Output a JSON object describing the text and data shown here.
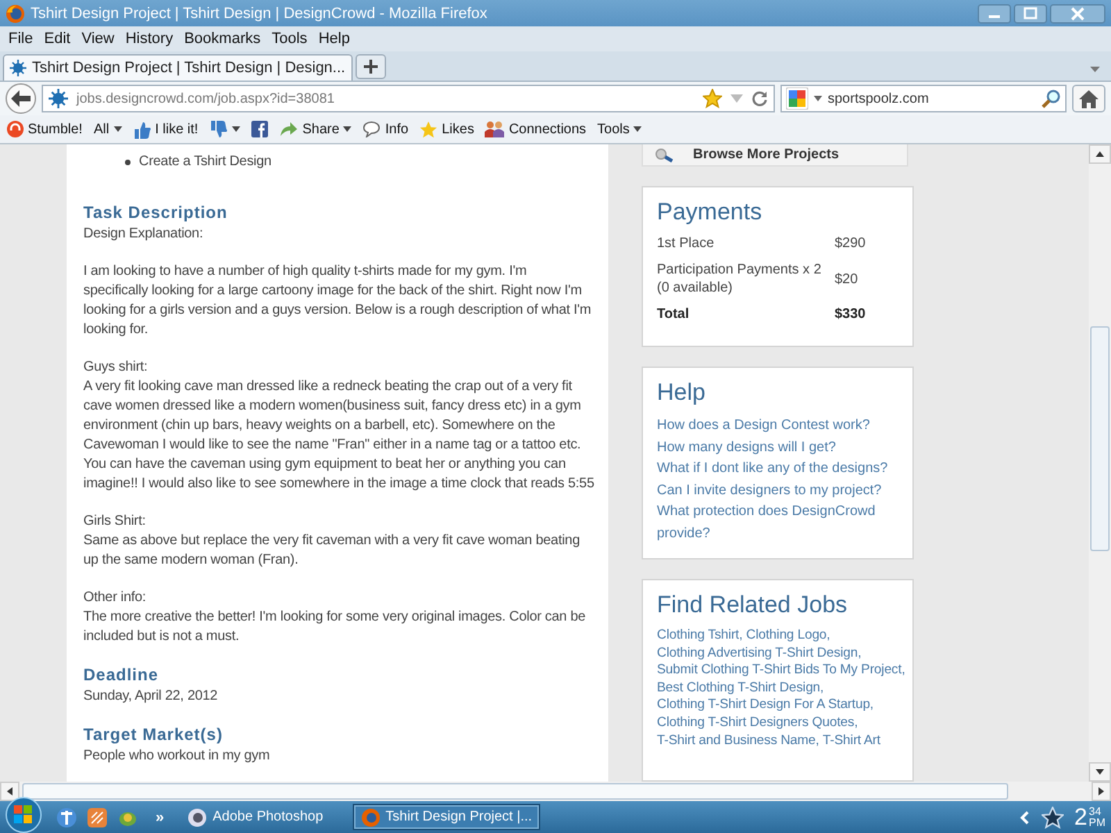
{
  "window": {
    "title": "Tshirt Design Project | Tshirt Design | DesignCrowd - Mozilla Firefox"
  },
  "menu": [
    "File",
    "Edit",
    "View",
    "History",
    "Bookmarks",
    "Tools",
    "Help"
  ],
  "tabs": [
    {
      "label": "Tshirt Design Project | Tshirt Design | Design...",
      "selected": true
    }
  ],
  "address": {
    "url": "jobs.designcrowd.com/job.aspx?id=38081"
  },
  "search": {
    "value": "sportspoolz.com"
  },
  "toolbar": [
    {
      "label": "Stumble!",
      "dropdown": false
    },
    {
      "label": "All",
      "dropdown": true
    },
    {
      "label": "I like it!",
      "dropdown": false
    },
    {
      "dropdown": true
    },
    {
      "dropdown": false
    },
    {
      "label": "Share",
      "dropdown": true
    },
    {
      "label": "Info",
      "dropdown": false
    },
    {
      "label": "Likes",
      "dropdown": false
    },
    {
      "label": "Connections",
      "dropdown": false
    },
    {
      "label": "Tools",
      "dropdown": true
    }
  ],
  "main": {
    "bullets": [
      "Create a Tshirt Design"
    ],
    "sections": [
      {
        "heading": "Task Description",
        "paragraphs": [
          [
            "Design Explanation:"
          ],
          [
            "I am looking to have a number of high quality t-shirts made for my gym. I'm specifically looking for a large cartoony image for the back of the shirt. Right now I'm looking for a girls version and a guys version. Below is a rough description of what I'm looking for."
          ],
          [
            "Guys shirt:",
            "A very fit looking cave man dressed like a redneck beating the crap out of a very fit cave women dressed like a modern women(business suit, fancy dress etc) in a gym environment (chin up bars, heavy weights on a barbell, etc). Somewhere on the Cavewoman I would like to see the name \"Fran\" either in a name tag or a tattoo etc. You can have the caveman using gym equipment to beat her or anything you can imagine!! I would also like to see somewhere in the image a time clock that reads 5:55"
          ],
          [
            "Girls Shirt:",
            "Same as above but replace the very fit caveman with a very fit cave woman beating up the same modern woman (Fran)."
          ],
          [
            "Other info:",
            "The more creative the better! I'm looking for some very original images. Color can be included but is not a must."
          ]
        ]
      },
      {
        "heading": "Deadline",
        "paragraphs": [
          [
            "Sunday, April 22, 2012"
          ]
        ]
      },
      {
        "heading": "Target Market(s)",
        "paragraphs": [
          [
            "People who workout in my gym"
          ]
        ]
      }
    ]
  },
  "sidebar": {
    "browse": "Browse More Projects",
    "payments": {
      "title": "Payments",
      "rows": [
        {
          "kind": "item",
          "label": "1st Place",
          "amount": "$290"
        },
        {
          "kind": "item",
          "label": "Participation Payments x 2",
          "note": "(0 available)",
          "amount": "$20"
        },
        {
          "kind": "total",
          "label": "Total",
          "amount": "$330"
        }
      ]
    },
    "help": {
      "title": "Help",
      "links": [
        "How does a Design Contest work?",
        "How many designs will I get?",
        "What if I dont like any of the designs?",
        "Can I invite designers to my project?",
        "What protection does DesignCrowd provide?"
      ]
    },
    "related": {
      "title": "Find Related Jobs",
      "links": [
        "Clothing Tshirt,",
        "Clothing Logo,",
        "Clothing Advertising T-Shirt Design,",
        "Submit Clothing T-Shirt Bids To My Project,",
        "Best Clothing T-Shirt Design,",
        "Clothing T-Shirt Design For A Startup,",
        "Clothing T-Shirt Designers Quotes,",
        "T-Shirt and Business Name,",
        "T-Shirt Art"
      ]
    }
  },
  "taskbar": {
    "more": "»",
    "windows": [
      {
        "label": "Adobe Photoshop",
        "selected": false
      },
      {
        "label": "Tshirt Design Project |...",
        "selected": true
      }
    ],
    "clock": {
      "hour": "2",
      "minute": "34",
      "period": "PM"
    }
  }
}
